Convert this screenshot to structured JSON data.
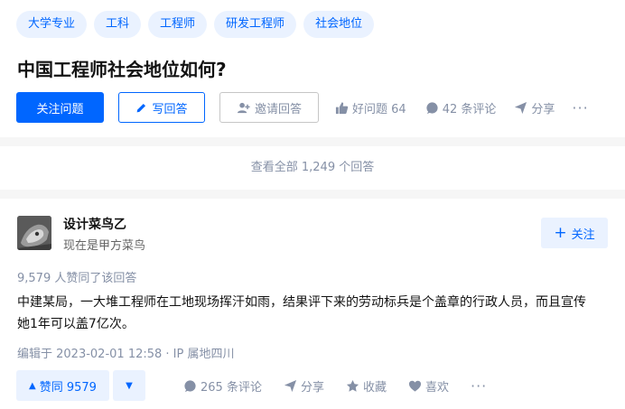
{
  "question": {
    "tags": [
      "大学专业",
      "工科",
      "工程师",
      "研发工程师",
      "社会地位"
    ],
    "title": "中国工程师社会地位如何?",
    "follow_label": "关注问题",
    "write_answer_label": "写回答",
    "invite_label": "邀请回答",
    "good_question_label": "好问题 64",
    "comments_label": "42 条评论",
    "share_label": "分享",
    "more_label": "···"
  },
  "view_all_label": "查看全部 1,249 个回答",
  "answer": {
    "author_name": "设计菜鸟乙",
    "author_bio": "现在是甲方菜鸟",
    "follow_label": "关注",
    "votes_summary": "9,579 人赞同了该回答",
    "content": "中建某局，一大堆工程师在工地现场挥汗如雨，结果评下来的劳动标兵是个盖章的行政人员，而且宣传她1年可以盖7亿次。",
    "edit_info": "编辑于 2023-02-01 12:58 · IP 属地四川",
    "upvote_label": "赞同 9579",
    "comments_label": "265 条评论",
    "share_label": "分享",
    "collect_label": "收藏",
    "like_label": "喜欢",
    "more_label": "···"
  },
  "colors": {
    "accent": "#0066ff",
    "accent_light": "#eaf2ff",
    "muted": "#8590a6"
  }
}
